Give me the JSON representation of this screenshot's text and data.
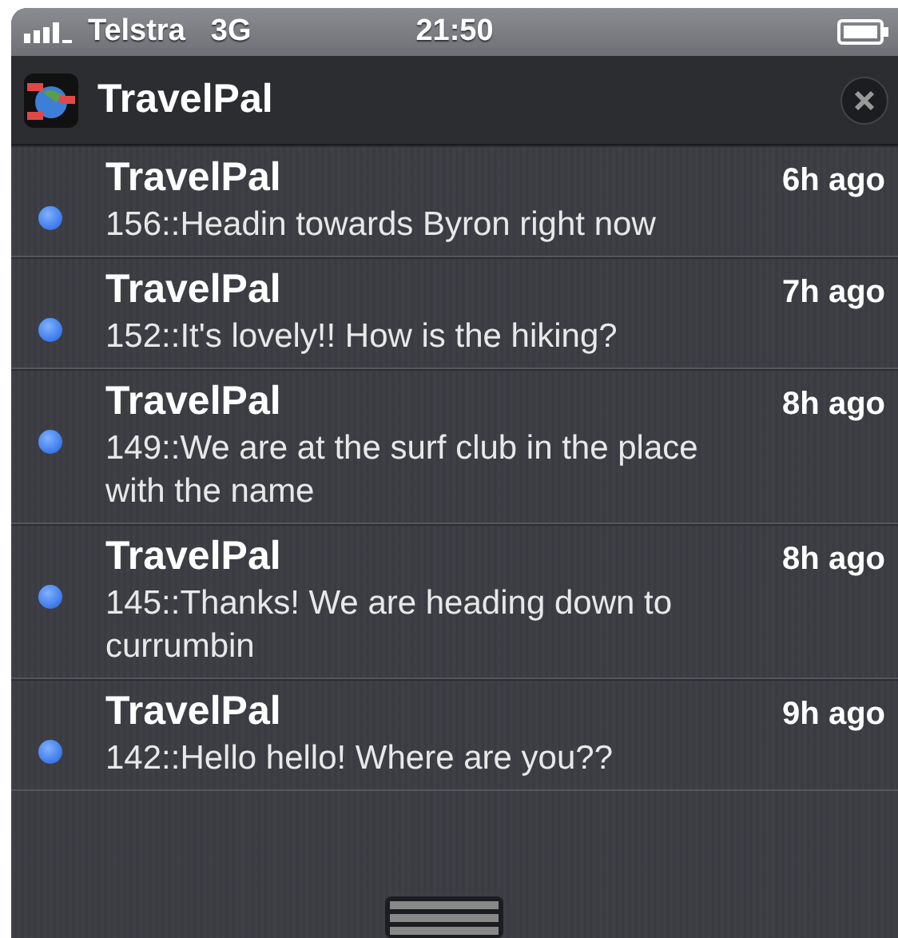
{
  "status_bar": {
    "carrier": "Telstra",
    "network": "3G",
    "time": "21:50"
  },
  "app_header": {
    "title": "TravelPal"
  },
  "notifications": [
    {
      "title": "TravelPal",
      "time": "6h ago",
      "message": "156::Headin towards Byron right now",
      "unread": true
    },
    {
      "title": "TravelPal",
      "time": "7h ago",
      "message": "152::It's lovely!! How is the hiking?",
      "unread": true
    },
    {
      "title": "TravelPal",
      "time": "8h ago",
      "message": "149::We are at the surf club in the place with the name",
      "unread": true
    },
    {
      "title": "TravelPal",
      "time": "8h ago",
      "message": "145::Thanks! We are heading down to currumbin",
      "unread": true
    },
    {
      "title": "TravelPal",
      "time": "9h ago",
      "message": "142::Hello hello! Where are you??",
      "unread": true
    }
  ]
}
